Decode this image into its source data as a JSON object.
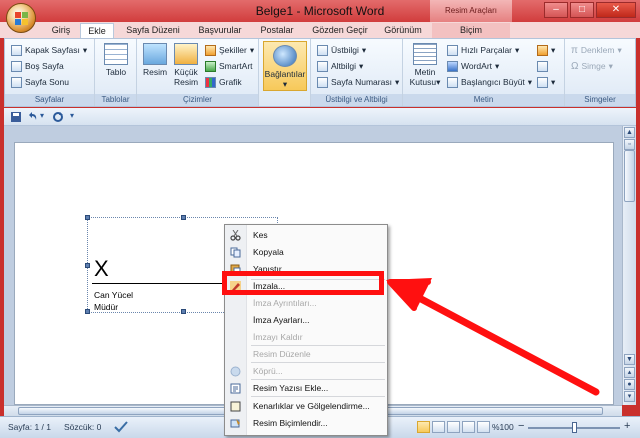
{
  "window": {
    "title": "Belge1 - Microsoft Word",
    "context_tab_group": "Resim Araçları",
    "controls": {
      "minimize": "–",
      "maximize": "□",
      "close": "✕"
    }
  },
  "tabs": [
    {
      "label": "Giriş"
    },
    {
      "label": "Ekle",
      "active": true
    },
    {
      "label": "Sayfa Düzeni"
    },
    {
      "label": "Başvurular"
    },
    {
      "label": "Postalar"
    },
    {
      "label": "Gözden Geçir"
    },
    {
      "label": "Görünüm"
    },
    {
      "label": "Biçim"
    }
  ],
  "ribbon": {
    "groups": {
      "sayfalar": {
        "label": "Sayfalar",
        "items": [
          "Kapak Sayfası",
          "Boş Sayfa",
          "Sayfa Sonu"
        ]
      },
      "tablolar": {
        "label": "Tablolar",
        "tablo": "Tablo"
      },
      "cizimler": {
        "label": "Çizimler",
        "resim": "Resim",
        "kucuk_resim_1": "Küçük",
        "kucuk_resim_2": "Resim",
        "sekiller": "Şekiller",
        "smartart": "SmartArt",
        "grafik": "Grafik"
      },
      "baglantilar": {
        "label": "Bağlantılar"
      },
      "ustbilgi": {
        "label": "Üstbilgi ve Altbilgi",
        "items": [
          "Üstbilgi",
          "Altbilgi",
          "Sayfa Numarası"
        ]
      },
      "metin": {
        "label": "Metin",
        "metin_kutusu_1": "Metin",
        "metin_kutusu_2": "Kutusu",
        "items": [
          "Hızlı Parçalar",
          "WordArt",
          "Başlangıcı Büyüt"
        ]
      },
      "simgeler": {
        "label": "Simgeler",
        "items": [
          "Denklem",
          "Simge"
        ]
      }
    }
  },
  "document": {
    "signature": {
      "mark": "X",
      "name": "Can Yücel",
      "title": "Müdür"
    }
  },
  "context_menu": {
    "items": [
      {
        "label": "Kes",
        "icon": "scissors-icon",
        "enabled": true
      },
      {
        "label": "Kopyala",
        "icon": "copy-icon",
        "enabled": true
      },
      {
        "label": "Yapıştır",
        "icon": "paste-icon",
        "enabled": true
      },
      {
        "label": "İmzala...",
        "icon": "sign-icon",
        "enabled": true
      },
      {
        "label": "İmza Ayrıntıları...",
        "icon": "",
        "enabled": false
      },
      {
        "label": "İmza Ayarları...",
        "icon": "",
        "enabled": true
      },
      {
        "label": "İmzayı Kaldır",
        "icon": "",
        "enabled": false
      },
      {
        "label": "Resim Düzenle",
        "icon": "",
        "enabled": false
      },
      {
        "label": "Köprü...",
        "icon": "hyperlink-icon",
        "enabled": false
      },
      {
        "label": "Resim Yazısı Ekle...",
        "icon": "caption-icon",
        "enabled": true
      },
      {
        "label": "Kenarlıklar ve Gölgelendirme...",
        "icon": "borders-icon",
        "enabled": true
      },
      {
        "label": "Resim Biçimlendir...",
        "icon": "format-picture-icon",
        "enabled": true
      }
    ]
  },
  "status_bar": {
    "page": "Sayfa: 1 / 1",
    "words": "Sözcük: 0",
    "zoom": "%100"
  },
  "colors": {
    "annotation": "#ff1010",
    "window_frame": "#c9302c",
    "ribbon_accent": "#3b5a82"
  }
}
